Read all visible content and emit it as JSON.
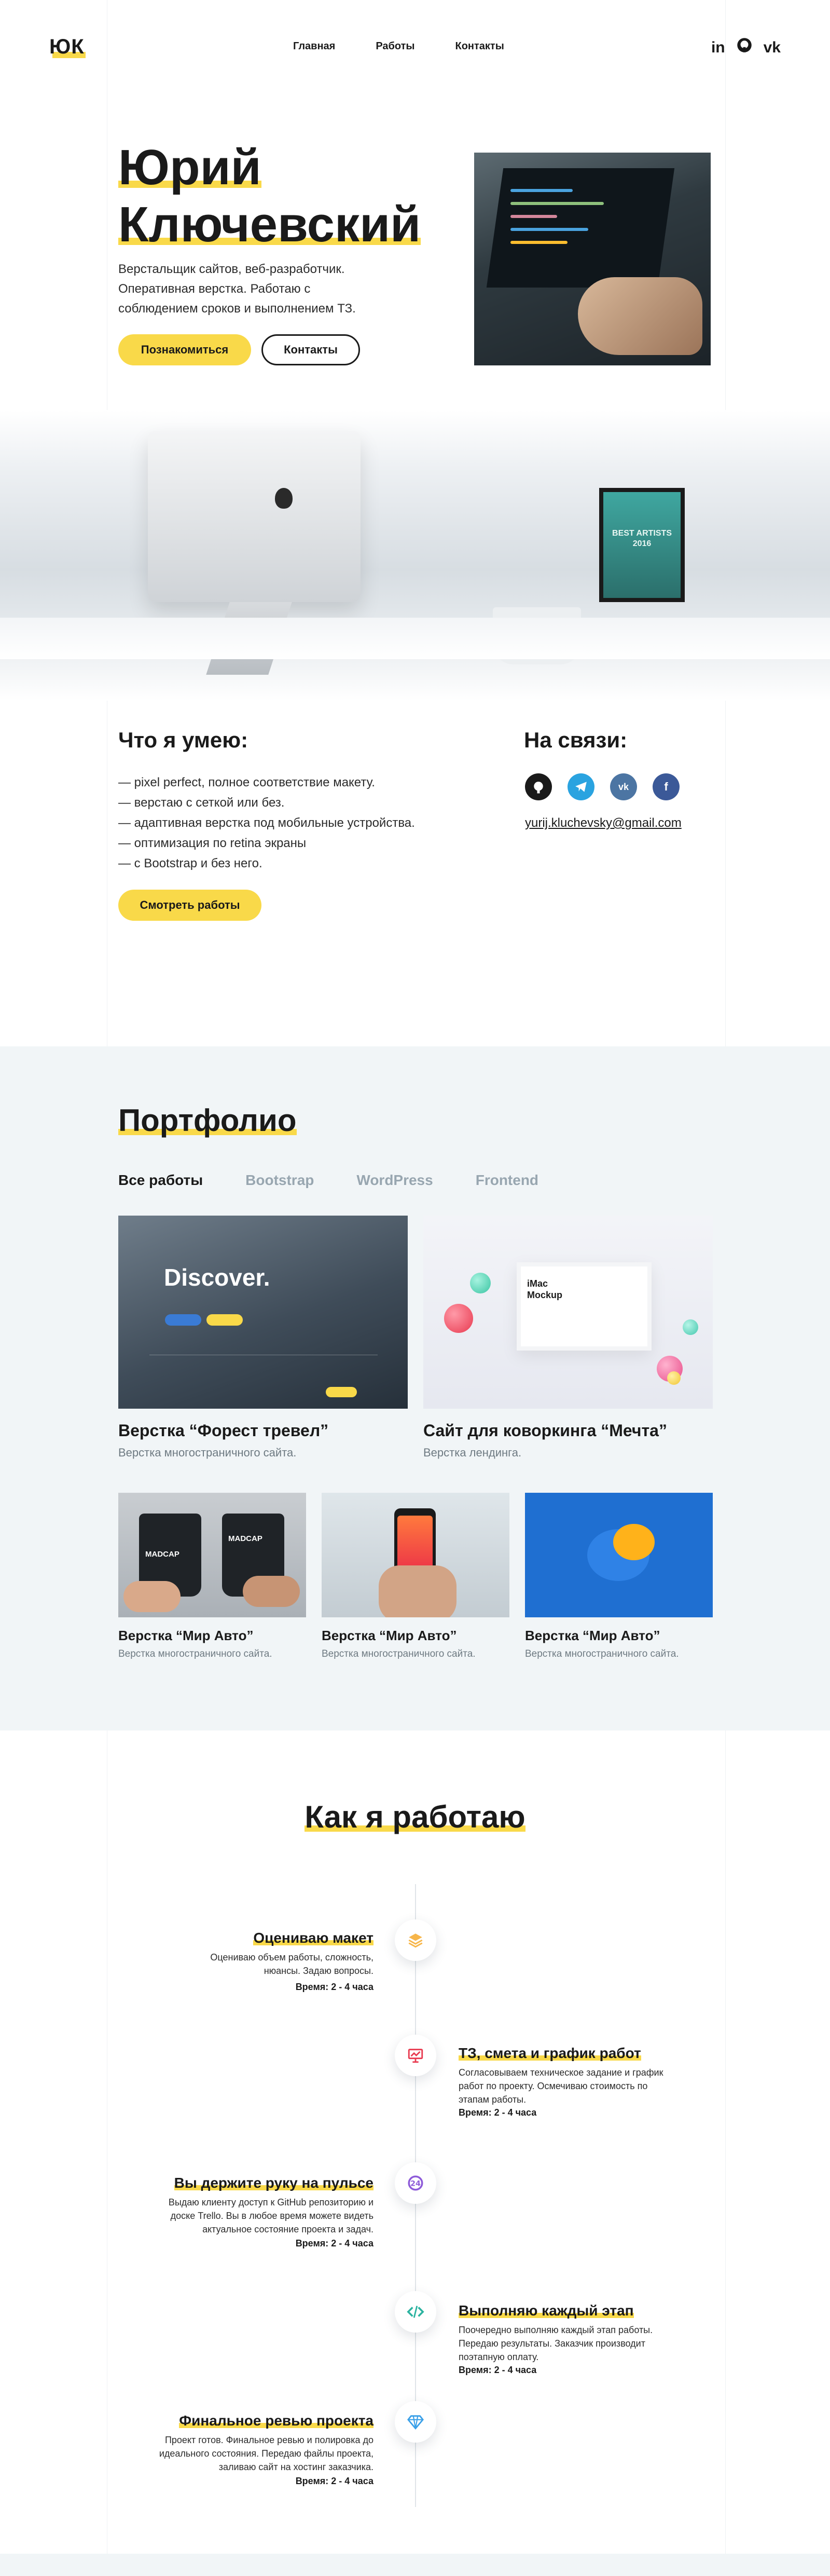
{
  "header": {
    "logo": "ЮК",
    "nav": [
      "Главная",
      "Работы",
      "Контакты"
    ],
    "socials": [
      "linkedin-icon",
      "github-icon",
      "vk-icon"
    ]
  },
  "hero": {
    "name_line1": "Юрий",
    "name_line2": "Ключевский",
    "desc_line1": "Верстальщик сайтов, веб-разработчик.",
    "desc_line2": "Оперативная верстка. Работаю с",
    "desc_line3": "соблюдением сроков и выполнением ТЗ.",
    "btn_primary": "Познакомиться",
    "btn_secondary": "Контакты",
    "poster_text": "BEST ARTISTS 2016"
  },
  "skills": {
    "title": "Что я умею:",
    "items": [
      "— pixel perfect, полное соответствие макету.",
      "— верстаю с сеткой или без.",
      "— адаптивная верстка под мобильные устройства.",
      "— оптимизация по retina экраны",
      "— с Bootstrap и без него."
    ],
    "button": "Смотреть работы"
  },
  "contacts": {
    "title": "На связи:",
    "icons": [
      "github-icon",
      "telegram-icon",
      "vk-icon",
      "facebook-icon"
    ],
    "email": "yurij.kluchevsky@gmail.com"
  },
  "portfolio": {
    "title": "Портфолио",
    "filters": [
      "Все работы",
      "Bootstrap",
      "WordPress",
      "Frontend"
    ],
    "cards": [
      {
        "title": "Верстка “Форест тревел”",
        "subtitle": "Верстка многостраничного сайта.",
        "img_text": "Discover."
      },
      {
        "title": "Сайт для коворкинга “Мечта”",
        "subtitle": "Верстка лендинга.",
        "img_text": "iMac Mockup"
      },
      {
        "title": "Верстка “Мир Авто”",
        "subtitle": "Верстка многостраничного сайта.",
        "img_text": "MADCAP"
      },
      {
        "title": "Верстка “Мир Авто”",
        "subtitle": "Верстка многостраничного сайта."
      },
      {
        "title": "Верстка “Мир Авто”",
        "subtitle": "Верстка многостраничного сайта."
      }
    ]
  },
  "process": {
    "title": "Как я работаю",
    "steps": [
      {
        "title": "Оцениваю макет",
        "text": "Оцениваю объем работы, сложность, нюансы. Задаю вопросы.",
        "time": "Время: 2 - 4 часа",
        "icon": "layers-icon"
      },
      {
        "title": "ТЗ, смета и график работ",
        "text": "Согласовываем техническое задание и график работ по проекту. Оcмечиваю стоимость по этапам работы.",
        "time": "Время: 2 - 4 часа",
        "icon": "presentation-icon"
      },
      {
        "title": "Вы держите руку на пульсе",
        "text": "Выдаю клиенту доступ к GitHub репозиторию и доске Trello. Вы в любое время можете видеть актуальное состояние проекта и задач.",
        "time": "Время: 2 - 4 часа",
        "icon": "clock-icon"
      },
      {
        "title": "Выполняю каждый этап",
        "text": "Поочередно выполняю каждый этап работы. Передаю результаты. Заказчик производит поэтапную оплату.",
        "time": "Время: 2 - 4 часа",
        "icon": "code-icon"
      },
      {
        "title": "Финальное ревью проекта",
        "text": "Проект готов. Финальное ревью и полировка до идеального состояния. Передаю файлы проекта, заливаю сайт на хостинг заказчика.",
        "time": "Время: 2 - 4 часа",
        "icon": "diamond-icon"
      }
    ]
  },
  "colors": {
    "accent": "#f9d949",
    "text": "#1a1a1a",
    "muted": "#98a6b0",
    "section_bg": "#f1f5f7"
  }
}
